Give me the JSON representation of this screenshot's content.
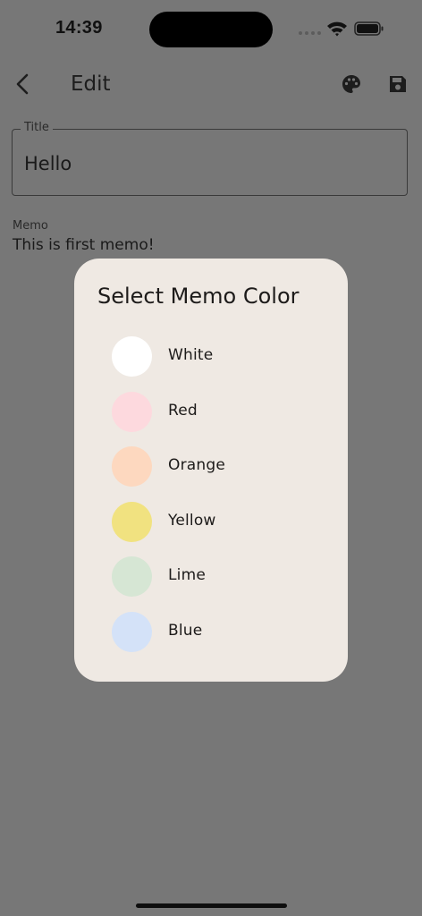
{
  "status_bar": {
    "time": "14:39"
  },
  "app_bar": {
    "title": "Edit",
    "back_icon": "chevron-left-icon",
    "palette_icon": "palette-icon",
    "save_icon": "save-icon"
  },
  "form": {
    "title_label": "Title",
    "title_value": "Hello",
    "memo_label": "Memo",
    "memo_value": "This is first memo!"
  },
  "dialog": {
    "title": "Select Memo Color",
    "colors": [
      {
        "label": "White",
        "hex": "#ffffff"
      },
      {
        "label": "Red",
        "hex": "#fdd9de"
      },
      {
        "label": "Orange",
        "hex": "#fdd8bf"
      },
      {
        "label": "Yellow",
        "hex": "#f1e280"
      },
      {
        "label": "Lime",
        "hex": "#d6e6d4"
      },
      {
        "label": "Blue",
        "hex": "#d4e2f8"
      }
    ]
  },
  "colors": {
    "scrim_background": "#777777",
    "dialog_background": "#efe9e3"
  }
}
